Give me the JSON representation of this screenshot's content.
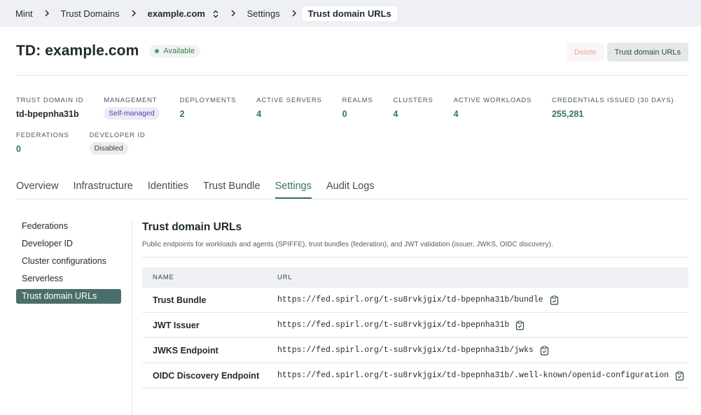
{
  "breadcrumb": {
    "items": [
      "Mint",
      "Trust Domains",
      "example.com",
      "Settings",
      "Trust domain URLs"
    ]
  },
  "header": {
    "title": "TD: example.com",
    "status": "Available",
    "delete_label": "Delete",
    "urls_label": "Trust domain URLs"
  },
  "stats": {
    "trust_domain_id": {
      "label": "TRUST DOMAIN ID",
      "value": "td-bpepnha31b"
    },
    "management": {
      "label": "MANAGEMENT",
      "value": "Self-managed"
    },
    "deployments": {
      "label": "DEPLOYMENTS",
      "value": "2"
    },
    "active_servers": {
      "label": "ACTIVE SERVERS",
      "value": "4"
    },
    "realms": {
      "label": "REALMS",
      "value": "0"
    },
    "clusters": {
      "label": "CLUSTERS",
      "value": "4"
    },
    "active_workloads": {
      "label": "ACTIVE WORKLOADS",
      "value": "4"
    },
    "credentials": {
      "label": "CREDENTIALS ISSUED (30 DAYS)",
      "value": "255,281"
    },
    "federations": {
      "label": "FEDERATIONS",
      "value": "0"
    },
    "developer_id": {
      "label": "DEVELOPER ID",
      "value": "Disabled"
    }
  },
  "tabs": [
    "Overview",
    "Infrastructure",
    "Identities",
    "Trust Bundle",
    "Settings",
    "Audit Logs"
  ],
  "sidenav": [
    "Federations",
    "Developer ID",
    "Cluster configurations",
    "Serverless",
    "Trust domain URLs"
  ],
  "section": {
    "title": "Trust domain URLs",
    "description": "Public endpoints for workloads and agents (SPIFFE), trust bundles (federation), and JWT validation (issuer, JWKS, OIDC discovery)."
  },
  "table": {
    "headers": {
      "name": "NAME",
      "url": "URL"
    },
    "rows": [
      {
        "name": "Trust Bundle",
        "url": "https://fed.spirl.org/t-su8rvkjgix/td-bpepnha31b/bundle"
      },
      {
        "name": "JWT Issuer",
        "url": "https://fed.spirl.org/t-su8rvkjgix/td-bpepnha31b"
      },
      {
        "name": "JWKS Endpoint",
        "url": "https://fed.spirl.org/t-su8rvkjgix/td-bpepnha31b/jwks"
      },
      {
        "name": "OIDC Discovery Endpoint",
        "url": "https://fed.spirl.org/t-su8rvkjgix/td-bpepnha31b/.well-known/openid-configuration"
      }
    ]
  },
  "colors": {
    "accent": "#36706a",
    "sidebar_active": "#4a6f6a",
    "status_green": "#48a868",
    "topbar_bg": "#eef0f6"
  },
  "icons": {
    "breadcrumb_separator": "chevron-right-icon",
    "domain_switcher": "chevron-up-down-icon",
    "copy": "clipboard-copy-icon",
    "status": "status-dot-icon"
  }
}
